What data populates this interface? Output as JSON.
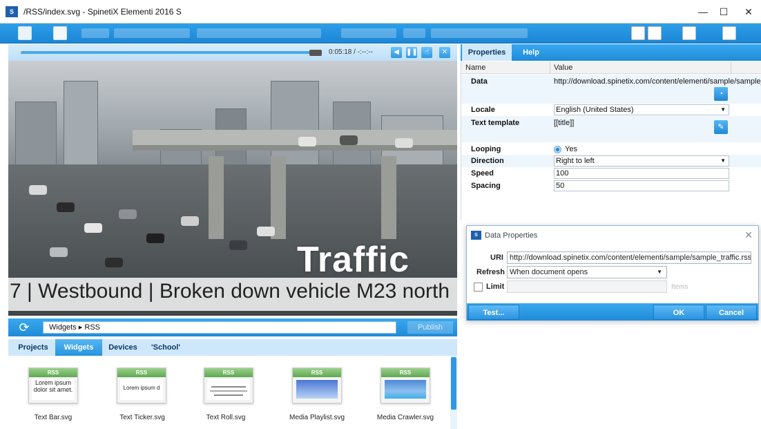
{
  "window": {
    "title": "/RSS/index.svg - SpinetiX Elementi 2016 S",
    "minimize_glyph": "—",
    "maximize_glyph": "☐",
    "close_glyph": "✕"
  },
  "player": {
    "time": "0:05:18 / -:--:--",
    "scene_title": "Traffic",
    "ticker_text": "7 | Westbound | Broken down vehicle  M23 north"
  },
  "widget_browser": {
    "path": "Widgets ▸ RSS",
    "publish_label": "Publish",
    "tabs": [
      "Projects",
      "Widgets",
      "Devices",
      "'School'"
    ],
    "active_tab": "Widgets",
    "items": [
      {
        "label": "Text Bar.svg",
        "header": "RSS",
        "preview": "Lorem ipsum dolor sit amet."
      },
      {
        "label": "Text Ticker.svg",
        "header": "RSS",
        "preview": "Lorem ipsum d"
      },
      {
        "label": "Text Roll.svg",
        "header": "RSS",
        "preview": ""
      },
      {
        "label": "Media Playlist.svg",
        "header": "RSS",
        "preview": ""
      },
      {
        "label": "Media Crawler.svg",
        "header": "RSS",
        "preview": ""
      }
    ]
  },
  "properties": {
    "tabs": [
      "Properties",
      "Help"
    ],
    "active_tab": "Properties",
    "col_name": "Name",
    "col_value": "Value",
    "rows": {
      "data": {
        "name": "Data",
        "value": "http://download.spinetix.com/content/elementi/sample/sample_traffic.rss"
      },
      "locale": {
        "name": "Locale",
        "value": "English (United States)"
      },
      "text_template": {
        "name": "Text template",
        "value": "[[title]]"
      },
      "looping": {
        "name": "Looping",
        "value": "Yes"
      },
      "direction": {
        "name": "Direction",
        "value": "Right to left"
      },
      "speed": {
        "name": "Speed",
        "value": "100"
      },
      "spacing": {
        "name": "Spacing",
        "value": "50"
      }
    }
  },
  "dialog": {
    "title": "Data Properties",
    "uri_label": "URI",
    "uri_value": "http://download.spinetix.com/content/elementi/sample/sample_traffic.rss",
    "refresh_label": "Refresh",
    "refresh_value": "When document opens",
    "limit_label": "Limit",
    "items_label": "Items",
    "test_label": "Test...",
    "ok_label": "OK",
    "cancel_label": "Cancel"
  },
  "colors": {
    "accent": "#1f8bd8",
    "panel": "#cfe8fb"
  }
}
